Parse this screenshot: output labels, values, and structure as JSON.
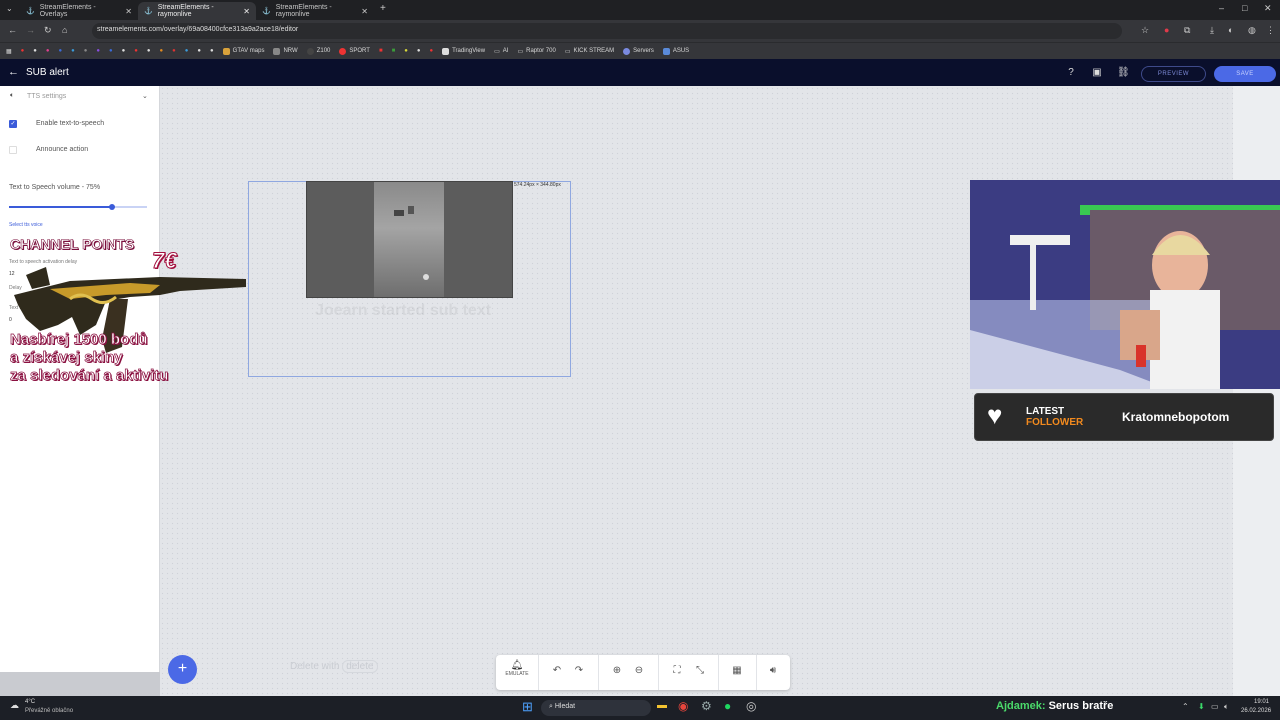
{
  "browser": {
    "tabs": [
      {
        "label": "StreamElements - Overlays",
        "active": false
      },
      {
        "label": "StreamElements - raymonlive",
        "active": true
      },
      {
        "label": "StreamElements - raymonlive",
        "active": false
      }
    ],
    "url": "streamelements.com/overlay/69a08400cfce313a9a2ace18/editor",
    "bookmarks": [
      "GTAV maps",
      "NRW",
      "Z100",
      "SPORT",
      "TradingView",
      "AI",
      "Raptor 700",
      "KICK STREAM",
      "Servers",
      "ASUS"
    ]
  },
  "app": {
    "title": "SUB alert",
    "preview_label": "PREVIEW",
    "save_label": "SAVE",
    "accent": "#4b69e6"
  },
  "panel": {
    "section": "TTS settings",
    "enable_tts": "Enable text-to-speech",
    "announce": "Announce action",
    "volume_label": "Text to Speech volume - 75%",
    "volume": 0.75,
    "select_voice": "Select tts voice",
    "activation_delay": "Text to speech activation delay",
    "delay_value": "12",
    "delay_unit": "Delay",
    "activation_amount": "Text to speech activation amount",
    "amount_value": "0"
  },
  "overlay": {
    "channel_points": "CHANNEL POINTS",
    "price": "7€",
    "line1": "Nasbírej 1500 bodů",
    "line2": "a získávej skiny",
    "line3": "za sledování a aktivitu",
    "size_label": "574.24px × 344.80px",
    "ghost_text": "Joearn started sub text"
  },
  "follower": {
    "heading1": "LATEST",
    "heading2": "FOLLOWER",
    "name": "Kratomnebopotom"
  },
  "editor": {
    "delete_hint": "Delete with",
    "delete_key": "delete",
    "emulate_label": "EMULATE"
  },
  "taskbar": {
    "weather_temp": "4°C",
    "weather_desc": "Převážně oblačno",
    "search": "Hledat",
    "chat_user": "Ajdamek:",
    "chat_text": "Serus bratře",
    "time": "19:01",
    "date": "26.02.2026"
  }
}
